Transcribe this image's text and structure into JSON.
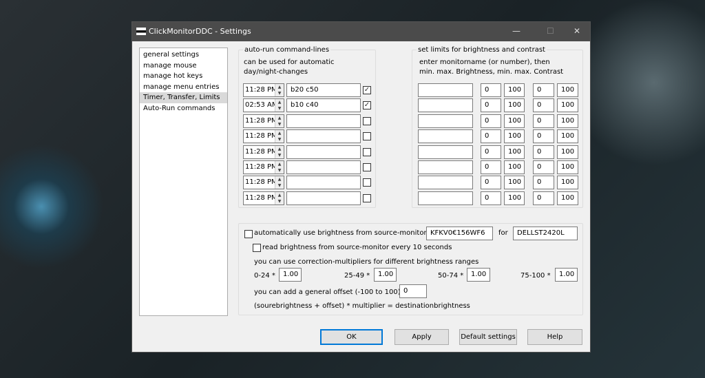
{
  "window": {
    "title": "ClickMonitorDDC - Settings",
    "minimize": "—",
    "maximize": "☐",
    "close": "✕"
  },
  "sidebar": {
    "items": [
      {
        "label": "general settings"
      },
      {
        "label": "manage mouse"
      },
      {
        "label": "manage hot keys"
      },
      {
        "label": "manage menu entries"
      },
      {
        "label": "Timer, Transfer, Limits",
        "selected": true
      },
      {
        "label": "Auto-Run commands"
      }
    ]
  },
  "autorun": {
    "title": "auto-run command-lines",
    "desc1": "can be used for automatic",
    "desc2": "day/night-changes",
    "rows": [
      {
        "time": "11:28 PM",
        "command": "b20 c50",
        "checked": true
      },
      {
        "time": "02:53 AM",
        "command": "b10 c40",
        "checked": true
      },
      {
        "time": "11:28 PM",
        "command": "",
        "checked": false
      },
      {
        "time": "11:28 PM",
        "command": "",
        "checked": false
      },
      {
        "time": "11:28 PM",
        "command": "",
        "checked": false
      },
      {
        "time": "11:28 PM",
        "command": "",
        "checked": false
      },
      {
        "time": "11:28 PM",
        "command": "",
        "checked": false
      },
      {
        "time": "11:28 PM",
        "command": "",
        "checked": false
      }
    ]
  },
  "limits": {
    "title": "set limits for brightness and contrast",
    "desc1": "enter monitorname (or number), then",
    "desc2": "min. max. Brightness, min. max. Contrast",
    "rows": [
      {
        "name": "",
        "bmin": "0",
        "bmax": "100",
        "cmin": "0",
        "cmax": "100"
      },
      {
        "name": "",
        "bmin": "0",
        "bmax": "100",
        "cmin": "0",
        "cmax": "100"
      },
      {
        "name": "",
        "bmin": "0",
        "bmax": "100",
        "cmin": "0",
        "cmax": "100"
      },
      {
        "name": "",
        "bmin": "0",
        "bmax": "100",
        "cmin": "0",
        "cmax": "100"
      },
      {
        "name": "",
        "bmin": "0",
        "bmax": "100",
        "cmin": "0",
        "cmax": "100"
      },
      {
        "name": "",
        "bmin": "0",
        "bmax": "100",
        "cmin": "0",
        "cmax": "100"
      },
      {
        "name": "",
        "bmin": "0",
        "bmax": "100",
        "cmin": "0",
        "cmax": "100"
      },
      {
        "name": "",
        "bmin": "0",
        "bmax": "100",
        "cmin": "0",
        "cmax": "100"
      }
    ]
  },
  "transfer": {
    "auto_label": "automatically use brightness from source-monitor",
    "auto_checked": false,
    "source": "KFKV0€156WF6",
    "for_label": "for",
    "destination": "DELLST2420L",
    "read_label": "read brightness from source-monitor every 10 seconds",
    "read_checked": false,
    "multipliers_label": "you can use correction-multipliers for different brightness ranges",
    "ranges": [
      {
        "label": "0-24  *",
        "value": "1.00"
      },
      {
        "label": "25-49  *",
        "value": "1.00"
      },
      {
        "label": "50-74  *",
        "value": "1.00"
      },
      {
        "label": "75-100  *",
        "value": "1.00"
      }
    ],
    "offset_label": "you can add a general offset (-100 to 100)",
    "offset": "0",
    "formula": "(sourebrightness + offset) * multiplier = destinationbrightness"
  },
  "buttons": {
    "ok": "OK",
    "apply": "Apply",
    "default": "Default settings",
    "help": "Help"
  }
}
